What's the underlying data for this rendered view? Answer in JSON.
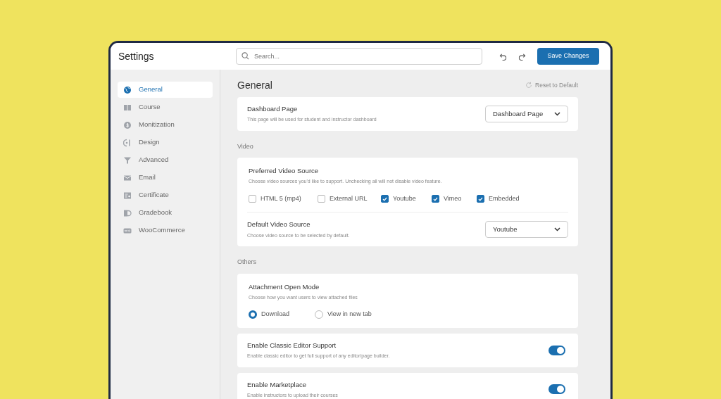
{
  "header": {
    "title": "Settings",
    "search": {
      "placeholder": "Search..."
    },
    "save_button": "Save Changes"
  },
  "sidebar": {
    "items": [
      {
        "label": "General",
        "selected": true
      },
      {
        "label": "Course",
        "selected": false
      },
      {
        "label": "Monitization",
        "selected": false
      },
      {
        "label": "Design",
        "selected": false
      },
      {
        "label": "Advanced",
        "selected": false
      },
      {
        "label": "Email",
        "selected": false
      },
      {
        "label": "Certificate",
        "selected": false
      },
      {
        "label": "Gradebook",
        "selected": false
      },
      {
        "label": "WooCommerce",
        "selected": false
      }
    ]
  },
  "content": {
    "title": "General",
    "reset": "Reset to Default",
    "groups": [
      {
        "cards": [
          [
            {
              "kind": "select",
              "title": "Dashboard Page",
              "description": "This page will be used for student and instructor dashboard",
              "value": "Dashboard Page"
            }
          ]
        ]
      },
      {
        "heading": "Video",
        "cards": [
          [
            {
              "kind": "checkboxes",
              "title": "Preferred Video Source",
              "description": "Choose video sources you'd like to support. Unchecking all will not disable video feature.",
              "options": [
                {
                  "label": "HTML 5 (mp4)",
                  "checked": false
                },
                {
                  "label": "External URL",
                  "checked": false
                },
                {
                  "label": "Youtube",
                  "checked": true
                },
                {
                  "label": "Vimeo",
                  "checked": true
                },
                {
                  "label": "Embedded",
                  "checked": true
                }
              ]
            },
            {
              "kind": "select",
              "title": "Default Video Source",
              "description": "Choose video source to be selected by default.",
              "value": "Youtube"
            }
          ]
        ]
      },
      {
        "heading": "Others",
        "cards": [
          [
            {
              "kind": "radios",
              "title": "Attachment Open Mode",
              "description": "Choose how you want users to view attached files",
              "options": [
                {
                  "label": "Download",
                  "selected": true
                },
                {
                  "label": "View in new tab",
                  "selected": false
                }
              ]
            }
          ],
          [
            {
              "kind": "toggle",
              "title": "Enable Classic Editor Support",
              "description": "Enable classic editor to get full support of any editor/page builder.",
              "on": true
            }
          ],
          [
            {
              "kind": "toggle",
              "title": "Enable Marketplace",
              "description": "Enable instructors to upload their courses",
              "on": true
            }
          ]
        ]
      }
    ]
  }
}
